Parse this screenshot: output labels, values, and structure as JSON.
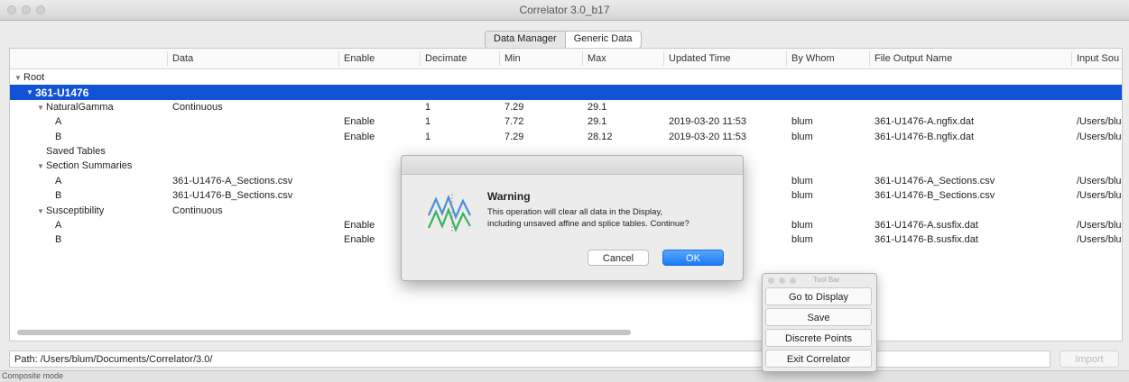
{
  "window": {
    "title": "Correlator 3.0_b17"
  },
  "tabs": [
    "Data Manager",
    "Generic Data"
  ],
  "columns": [
    "Data",
    "Enable",
    "Decimate",
    "Min",
    "Max",
    "Updated Time",
    "By Whom",
    "File Output Name",
    "Input Sou"
  ],
  "rows": [
    {
      "name": "Root",
      "indent": 0,
      "tri": true,
      "cells": [
        "",
        "",
        "",
        "",
        "",
        "",
        "",
        "",
        ""
      ]
    },
    {
      "name": "361-U1476",
      "indent": 1,
      "tri": true,
      "selected": true,
      "cells": [
        "",
        "",
        "",
        "",
        "",
        "",
        "",
        "",
        ""
      ]
    },
    {
      "name": "NaturalGamma",
      "indent": 2,
      "tri": true,
      "cells": [
        "Continuous",
        "",
        "1",
        "7.29",
        "29.1",
        "",
        "",
        "",
        ""
      ]
    },
    {
      "name": "A",
      "indent": 3,
      "cells": [
        "",
        "Enable",
        "1",
        "7.72",
        "29.1",
        "2019-03-20 11:53",
        "blum",
        "361-U1476-A.ngfix.dat",
        "/Users/blu"
      ]
    },
    {
      "name": "B",
      "indent": 3,
      "cells": [
        "",
        "Enable",
        "1",
        "7.29",
        "28.12",
        "2019-03-20 11:53",
        "blum",
        "361-U1476-B.ngfix.dat",
        "/Users/blu"
      ]
    },
    {
      "name": "Saved Tables",
      "indent": 2,
      "cells": [
        "",
        "",
        "",
        "",
        "",
        "",
        "",
        "",
        ""
      ]
    },
    {
      "name": "Section Summaries",
      "indent": 2,
      "tri": true,
      "cells": [
        "",
        "",
        "",
        "",
        "",
        "",
        "",
        "",
        ""
      ]
    },
    {
      "name": "A",
      "indent": 3,
      "cells": [
        "361-U1476-A_Sections.csv",
        "",
        "",
        "",
        "",
        ":53",
        "blum",
        "361-U1476-A_Sections.csv",
        "/Users/blu"
      ]
    },
    {
      "name": "B",
      "indent": 3,
      "cells": [
        "361-U1476-B_Sections.csv",
        "",
        "",
        "",
        "",
        ":53",
        "blum",
        "361-U1476-B_Sections.csv",
        "/Users/blu"
      ]
    },
    {
      "name": "Susceptibility",
      "indent": 2,
      "tri": true,
      "cells": [
        "Continuous",
        "",
        "",
        "",
        "",
        "",
        "",
        "",
        ""
      ]
    },
    {
      "name": "A",
      "indent": 3,
      "cells": [
        "",
        "Enable",
        "",
        "",
        "",
        ":53",
        "blum",
        "361-U1476-A.susfix.dat",
        "/Users/blu"
      ]
    },
    {
      "name": "B",
      "indent": 3,
      "cells": [
        "",
        "Enable",
        "",
        "",
        "",
        ":53",
        "blum",
        "361-U1476-B.susfix.dat",
        "/Users/blu"
      ]
    }
  ],
  "path": {
    "value": "Path: /Users/blum/Documents/Correlator/3.0/"
  },
  "import_label": "Import",
  "status": "Composite mode",
  "dialog": {
    "title": "Warning",
    "message_line1": "This operation will clear all data in the Display,",
    "message_line2": "including unsaved affine and splice tables. Continue?",
    "cancel": "Cancel",
    "ok": "OK"
  },
  "toolbar": {
    "title": "Tool Bar",
    "buttons": [
      "Go to Display",
      "Save",
      "Discrete Points",
      "Exit Correlator"
    ]
  },
  "colors": {
    "selection": "#1253d6",
    "ok_button": "#1a7af5"
  }
}
